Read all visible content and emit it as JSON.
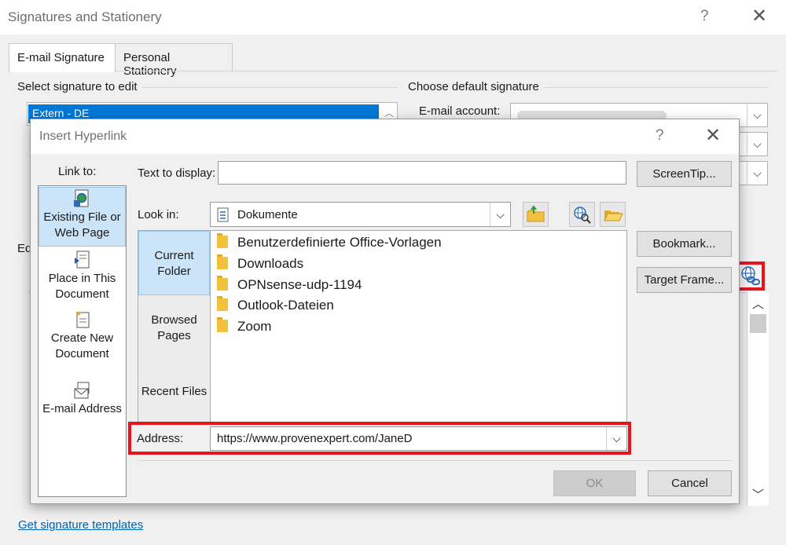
{
  "background_window": {
    "title": "Signatures and Stationery",
    "help_glyph": "?",
    "close_glyph": "✕",
    "tabs": [
      {
        "label": "E-mail Signature",
        "active": true
      },
      {
        "label": "Personal Stationery",
        "active": false
      }
    ],
    "select_signature_label": "Select signature to edit",
    "selected_signature": "Extern - DE",
    "default_signature_label": "Choose default signature",
    "email_account_label": "E-mail account:",
    "edit_label_partial": "Ed",
    "get_templates_link": "Get signature templates"
  },
  "dialog": {
    "title": "Insert Hyperlink",
    "help_glyph": "?",
    "close_glyph": "✕",
    "link_to_label": "Link to:",
    "link_to_items": [
      {
        "label": "Existing File or Web Page",
        "line1": "Existing File or",
        "line2": "Web Page",
        "icon": "web-page-icon",
        "selected": true
      },
      {
        "label": "Place in This Document",
        "line1": "Place in This",
        "line2": "Document",
        "icon": "document-place-icon",
        "selected": false
      },
      {
        "label": "Create New Document",
        "line1": "Create New",
        "line2": "Document",
        "icon": "new-document-icon",
        "selected": false
      },
      {
        "label": "E-mail Address",
        "line1": "E-mail Address",
        "line2": "",
        "icon": "email-icon",
        "selected": false
      }
    ],
    "text_to_display_label": "Text to display:",
    "text_to_display_value": "",
    "screentip_button": "ScreenTip...",
    "look_in_label": "Look in:",
    "look_in_value": "Dokumente",
    "side_items": [
      {
        "line1": "Current",
        "line2": "Folder",
        "selected": true
      },
      {
        "line1": "Browsed",
        "line2": "Pages",
        "selected": false
      },
      {
        "line1": "Recent Files",
        "line2": "",
        "selected": false
      }
    ],
    "files": [
      "Benutzerdefinierte Office-Vorlagen",
      "Downloads",
      "OPNsense-udp-1194",
      "Outlook-Dateien",
      "Zoom"
    ],
    "bookmark_button": "Bookmark...",
    "target_frame_button": "Target Frame...",
    "address_label": "Address:",
    "address_value": "https://www.provenexpert.com/JaneD",
    "ok_button": "OK",
    "cancel_button": "Cancel",
    "highlight_color": "#e8141c",
    "selection_color": "#cce4f7"
  }
}
